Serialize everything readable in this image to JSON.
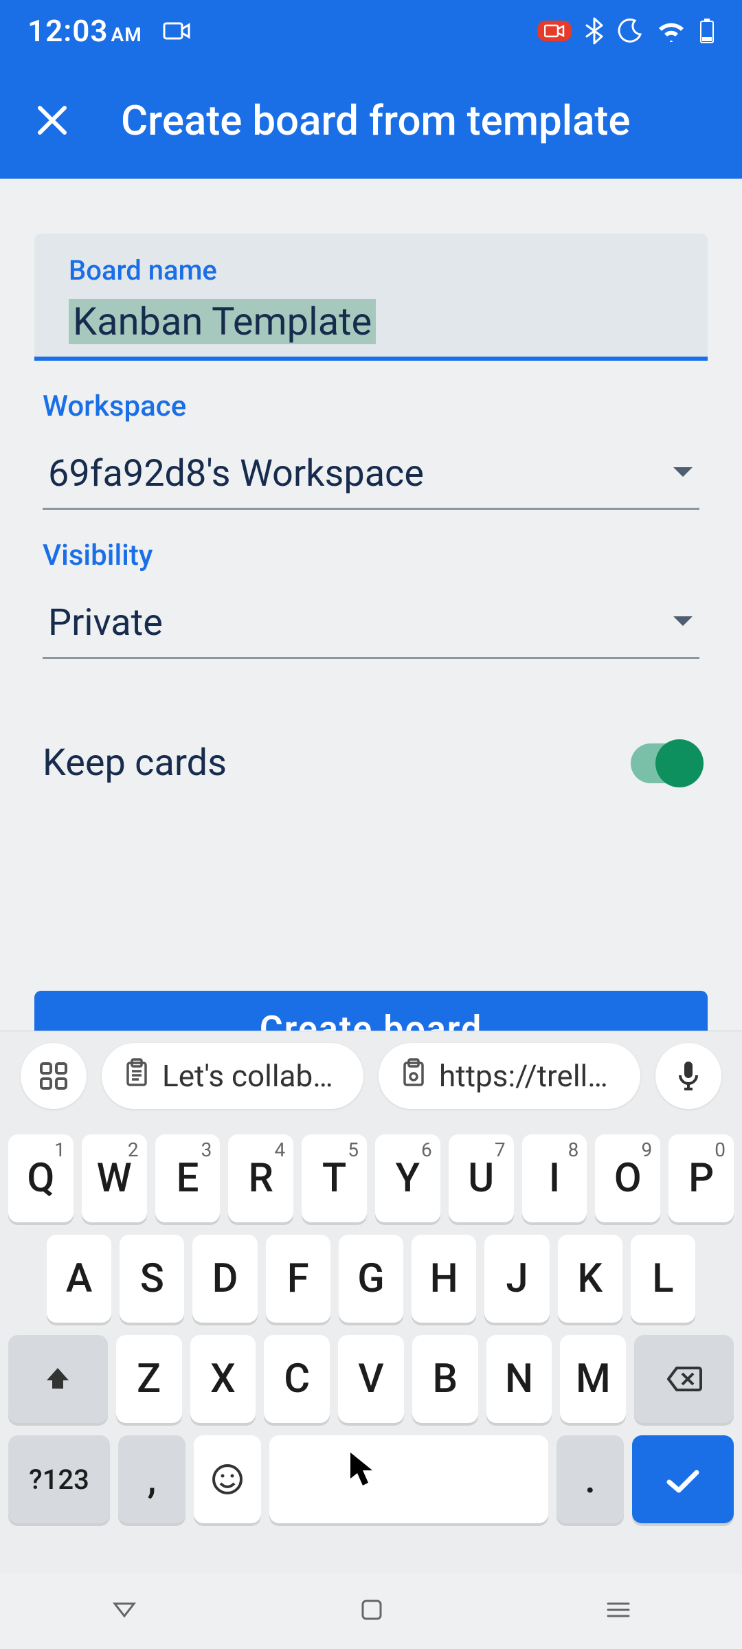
{
  "status": {
    "time": "12:03",
    "ampm": "AM"
  },
  "app_bar": {
    "title": "Create board from template"
  },
  "form": {
    "board_name_label": "Board name",
    "board_name_value": "Kanban Template",
    "workspace_label": "Workspace",
    "workspace_value": "69fa92d8's Workspace",
    "visibility_label": "Visibility",
    "visibility_value": "Private",
    "keep_cards_label": "Keep cards",
    "keep_cards_on": true,
    "create_label": "Create board"
  },
  "keyboard": {
    "suggestion1": "Let's collabo…",
    "suggestion2": "https://trello…",
    "row1": [
      "Q",
      "W",
      "E",
      "R",
      "T",
      "Y",
      "U",
      "I",
      "O",
      "P"
    ],
    "row1_sup": [
      "1",
      "2",
      "3",
      "4",
      "5",
      "6",
      "7",
      "8",
      "9",
      "0"
    ],
    "row2": [
      "A",
      "S",
      "D",
      "F",
      "G",
      "H",
      "J",
      "K",
      "L"
    ],
    "row3": [
      "Z",
      "X",
      "C",
      "V",
      "B",
      "N",
      "M"
    ],
    "sym_key": "?123",
    "comma_key": ",",
    "period_key": "."
  }
}
